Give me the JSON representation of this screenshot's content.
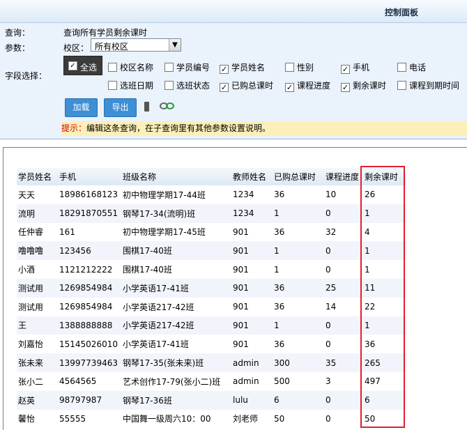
{
  "panel": {
    "title": "控制面板",
    "query_label": "查询：",
    "query_text": "查询所有学员剩余课时",
    "param_label": "参数：",
    "campus_label": "校区：",
    "campus_value": "所有校区",
    "fields_label": "字段选择：",
    "select_all": "全选",
    "fields": [
      {
        "label": "校区名称",
        "checked": false
      },
      {
        "label": "学员编号",
        "checked": false
      },
      {
        "label": "学员姓名",
        "checked": true
      },
      {
        "label": "性别",
        "checked": false
      },
      {
        "label": "手机",
        "checked": true
      },
      {
        "label": "电话",
        "checked": false
      },
      {
        "label": "选班日期",
        "checked": false
      },
      {
        "label": "选班状态",
        "checked": false
      },
      {
        "label": "已购总课时",
        "checked": true
      },
      {
        "label": "课程进度",
        "checked": true
      },
      {
        "label": "剩余课时",
        "checked": true
      },
      {
        "label": "课程到期时间",
        "checked": false
      }
    ],
    "load_button": "加载",
    "export_button": "导出",
    "hint_prefix": "提示：",
    "hint_text": "编辑这条查询，在子查询里有其他参数设置说明。"
  },
  "table": {
    "columns": [
      "学员姓名",
      "手机",
      "班级名称",
      "教师姓名",
      "已购总课时",
      "课程进度",
      "剩余课时"
    ],
    "rows": [
      [
        "天天",
        "18986168123",
        "初中物理学期17-44班",
        "1234",
        "36",
        "10",
        "26"
      ],
      [
        "流明",
        "18291870551",
        "钢琴17-34(流明)班",
        "1234",
        "1",
        "0",
        "1"
      ],
      [
        "任仲睿",
        "161",
        "初中物理学期17-45班",
        "901",
        "36",
        "32",
        "4"
      ],
      [
        "噜噜噜",
        "123456",
        "围棋17-40班",
        "901",
        "1",
        "0",
        "1"
      ],
      [
        "小酒",
        "1121212222",
        "围棋17-40班",
        "901",
        "1",
        "0",
        "1"
      ],
      [
        "测试用",
        "1269854984",
        "小学英语17-41班",
        "901",
        "36",
        "25",
        "11"
      ],
      [
        "测试用",
        "1269854984",
        "小学英语217-42班",
        "901",
        "36",
        "14",
        "22"
      ],
      [
        "王",
        "1388888888",
        "小学英语217-42班",
        "901",
        "1",
        "0",
        "1"
      ],
      [
        "刘嘉怡",
        "15145026010",
        "小学英语17-41班",
        "901",
        "36",
        "0",
        "36"
      ],
      [
        "张未来",
        "13997739463",
        "钢琴17-35(张未来)班",
        "admin",
        "300",
        "35",
        "265"
      ],
      [
        "张小二",
        "4564565",
        "艺术创作17-79(张小二)班",
        "admin",
        "500",
        "3",
        "497"
      ],
      [
        "赵英",
        "98797987",
        "钢琴17-36班",
        "lulu",
        "6",
        "0",
        "6"
      ],
      [
        "馨怡",
        "55555",
        "中国舞一级周六10：00",
        "刘老师",
        "50",
        "0",
        "50"
      ]
    ]
  },
  "colors": {
    "accent": "#3d8fd6",
    "highlight_border": "#e11e2e",
    "hint_bg": "#fcefb8",
    "panel_bg": "#eaf2fb"
  },
  "icons": [
    "phone-icon",
    "link-icon",
    "checkbox-checked-icon",
    "dropdown-arrow-icon"
  ]
}
